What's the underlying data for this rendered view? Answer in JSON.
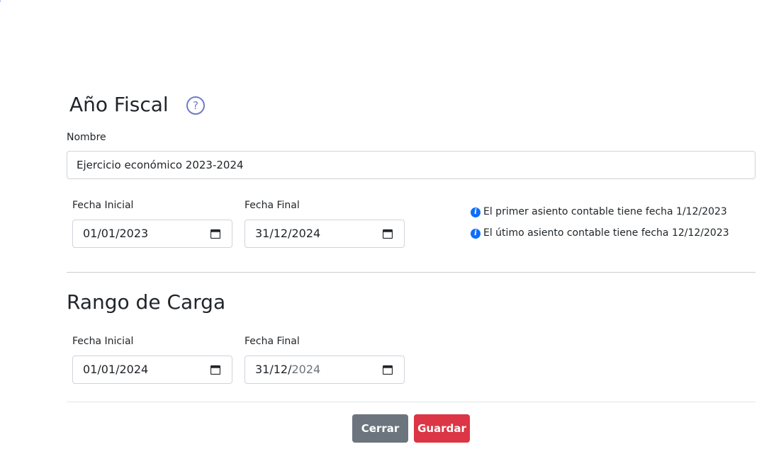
{
  "fiscal": {
    "title": "Año Fiscal",
    "help_icon": "?",
    "nombre_label": "Nombre",
    "nombre_value": "Ejercicio económico 2023-2024",
    "fecha_inicial_label": "Fecha Inicial",
    "fecha_inicial_value": "01/01/2023",
    "fecha_final_label": "Fecha Final",
    "fecha_final_value": "31/12/2024",
    "info": [
      "El primer asiento contable tiene fecha 1/12/2023",
      "El útimo asiento contable tiene fecha 12/12/2023"
    ]
  },
  "rango": {
    "title": "Rango de Carga",
    "fecha_inicial_label": "Fecha Inicial",
    "fecha_inicial_value": "01/01/2024",
    "fecha_final_label": "Fecha Final",
    "fecha_final_value_typed": "31/12/",
    "fecha_final_value_pending": "2024"
  },
  "buttons": {
    "cerrar": "Cerrar",
    "guardar": "Guardar"
  },
  "colors": {
    "help_icon": "#6f7bc9",
    "info_icon": "#0d6efd",
    "cerrar_bg": "#6c757d",
    "guardar_bg": "#dc3545"
  },
  "icons": {
    "help": "question-circle-icon",
    "info": "info-circle-icon",
    "date": "calendar-icon"
  }
}
